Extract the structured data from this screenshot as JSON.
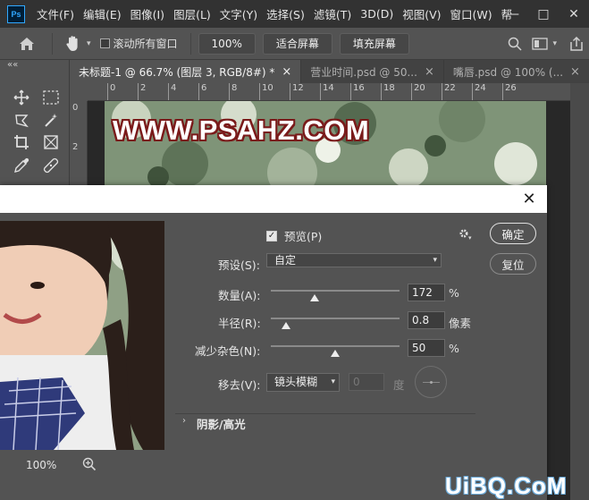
{
  "app": {
    "logo": "Ps"
  },
  "menu": [
    "文件(F)",
    "编辑(E)",
    "图像(I)",
    "图层(L)",
    "文字(Y)",
    "选择(S)",
    "滤镜(T)",
    "3D(D)",
    "视图(V)",
    "窗口(W)",
    "帮"
  ],
  "window_controls": {
    "minimize": "—",
    "restore": "□",
    "close": "✕"
  },
  "options": {
    "scroll_all_label": "滚动所有窗口",
    "zoom_value": "100%",
    "fit_screen": "适合屏幕",
    "fill_screen": "填充屏幕"
  },
  "panel": {
    "collapse": "««"
  },
  "tabs": [
    {
      "label": "未标题-1 @ 66.7% (图层 3, RGB/8#) *",
      "active": true
    },
    {
      "label": "营业时间.psd @ 50...",
      "active": false
    },
    {
      "label": "嘴唇.psd @ 100% (...",
      "active": false
    }
  ],
  "ruler": {
    "h_ticks": [
      "0",
      "2",
      "4",
      "6",
      "8",
      "10",
      "12",
      "14",
      "16",
      "18",
      "20",
      "22",
      "24",
      "26"
    ],
    "v_ticks": [
      "0",
      "2"
    ]
  },
  "canvas": {
    "watermark_text": "WWW.PSAHZ.COM"
  },
  "dialog": {
    "close": "✕",
    "preview_label": "预览(P)",
    "preset_label": "预设(S):",
    "preset_value": "自定",
    "ok": "确定",
    "reset": "复位",
    "amount_label": "数量(A):",
    "amount_value": "172",
    "amount_unit": "%",
    "amount_level": 0.34,
    "radius_label": "半径(R):",
    "radius_value": "0.8",
    "radius_unit": "像素",
    "radius_level": 0.12,
    "noise_label": "减少杂色(N):",
    "noise_value": "50",
    "noise_unit": "%",
    "noise_level": 0.5,
    "remove_label": "移去(V):",
    "remove_value": "镜头模糊",
    "angle_value": "0",
    "angle_unit": "度",
    "shadows_label": "阴影/高光",
    "zoom_level": "100%"
  },
  "site_watermark": "UiBQ.CoM",
  "colors": {
    "app_bg": "#535353",
    "menubar": "#323232",
    "watermark_outline": "#7a1a1a",
    "ps_blue": "#31a8ff"
  }
}
